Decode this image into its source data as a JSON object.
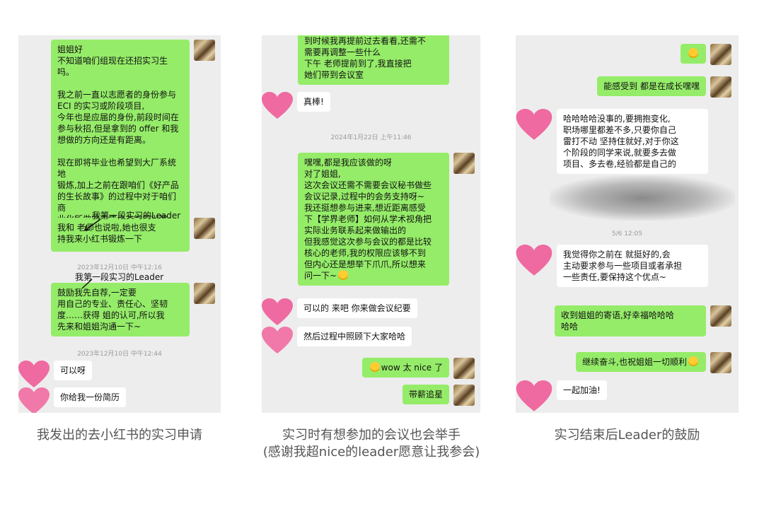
{
  "panel1": {
    "m1": "姐姐好\n不知道咱们组现在还招实习生吗。\n\n我之前一直以志愿者的身份参与\nECI 的实习或阶段项目,\n今年也是应届的身份,前段时间在\n参与秋招,但是拿到的 offer 和我\n想做的方向还是有距离。\n\n现在即将毕业也希望到大厂系统地\n锻炼,加上之前在跟咱们《好产品\n的生长故事》的过程中对于咱们商\n业化所做的事情也非常感兴趣,\n希望来和您自荐一下实习生,不知\n道有没有机会呀~",
    "anno1": "我第一段实习的Leader",
    "m2": "我和    老师也说啦,她也很支\n持我来小红书锻炼一下",
    "ts1": "2023年12月10日 中午12:16",
    "anno2": "我第一段实习的Leader",
    "m3": "      鼓励我先自荐,一定要\n用自己的专业、责任心、坚韧\n度……获得    姐的认可,所以我\n先来和姐姐沟通一下~",
    "ts2": "2023年12月10日 中午12:44",
    "m4": "可以呀",
    "m5": "你给我一份简历",
    "caption": "我发出的去小红书的实习申请"
  },
  "panel2": {
    "m1": "到时候我再提前过去看看,还需不\n需要再调整一些什么\n下午    老师提前到了,我直接把\n她们带到会议室",
    "m2": "真棒!",
    "ts1": "2024年1月22日 上午11:46",
    "m3": "嘿嘿,都是我应该做的呀\n对了姐姐,\n这次会议还需不需要会议秘书做些\n会议记录,过程中的会务支持呀~\n我还挺想参与进来,想近距离感受\n下【学界老师】如何从学术视角把\n实际业务联系起来做输出的\n但我感觉这次参与会议的都是比较\n核心的老师,我的权限应该够不到\n但内心还是想举下爪爪,所以想来\n问一下~",
    "m4": "可以的 来吧 你来做会议纪要",
    "m5": "然后过程中照顾下大家哈哈",
    "m6": "wow 太 nice 了",
    "m7": "带薪追星",
    "caption_line1": "实习时有想参加的会议也会举手",
    "caption_line2": "(感谢我超nice的leader愿意让我参会)"
  },
  "panel3": {
    "m2": "能感受到 都是在成长嘿嘿",
    "m3": "哈哈哈哈没事的,要拥抱变化,\n职场哪里都差不多,只要你自己\n雷打不动 坚持住就好,对于你这\n个阶段的同学来说,就要多去做\n项目、多去卷,经验都是自己的",
    "ts1": "5/6 12:05",
    "m4": "我觉得你之前在  就挺好的,会\n主动要求参与一些项目或者承担\n一些责任,要保持这个优点~",
    "m5": "收到姐姐的寄语,好幸福哈哈哈\n哈哈",
    "m6": "继续奋斗,也祝姐姐一切顺利",
    "m7": "一起加油!",
    "caption": "实习结束后Leader的鼓励"
  },
  "colors": {
    "panel_bg": "#ededed",
    "green_bubble": "#95ec69",
    "white_bubble": "#ffffff",
    "caption": "#555555"
  },
  "icons": {
    "right_avatar": "photo-avatar",
    "left_avatar": "pink-heart-avatar",
    "reaction": "emoji-face"
  }
}
